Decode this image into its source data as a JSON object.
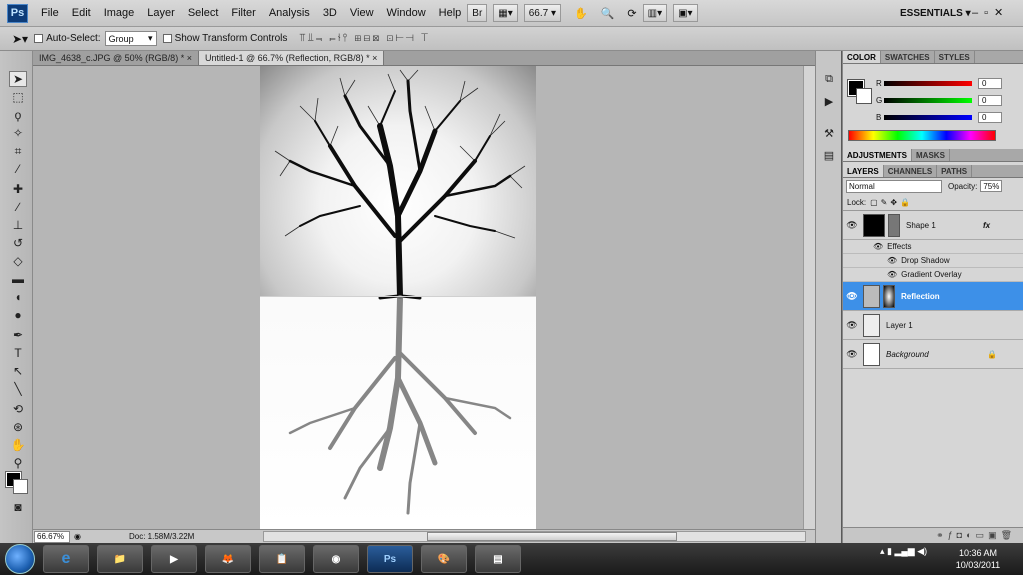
{
  "menubar": {
    "logo": "Ps",
    "items": [
      "File",
      "Edit",
      "Image",
      "Layer",
      "Select",
      "Filter",
      "Analysis",
      "3D",
      "View",
      "Window",
      "Help"
    ],
    "zoom": "66.7 ▾",
    "essentials": "ESSENTIALS ▾",
    "window_controls": "–▫✕"
  },
  "options": {
    "auto_select_label": "Auto-Select:",
    "auto_select_value": "Group",
    "transform_label": "Show Transform Controls"
  },
  "tabs": [
    {
      "label": "IMG_4638_c.JPG @ 50% (RGB/8) * ×"
    },
    {
      "label": "Untitled-1 @ 66.7% (Reflection, RGB/8) * ×"
    }
  ],
  "status": {
    "zoom": "66.67%",
    "doc": "Doc: 1.58M/3.22M"
  },
  "color_panel": {
    "tabs": [
      "COLOR",
      "SWATCHES",
      "STYLES"
    ],
    "r_label": "R",
    "g_label": "G",
    "b_label": "B",
    "r": "0",
    "g": "0",
    "b": "0"
  },
  "adjust_panel": {
    "tabs": [
      "ADJUSTMENTS",
      "MASKS"
    ]
  },
  "layers_panel": {
    "tabs": [
      "LAYERS",
      "CHANNELS",
      "PATHS"
    ],
    "blend_mode": "Normal",
    "opacity_label": "Opacity:",
    "opacity_value": "75%",
    "lock_label": "Lock:",
    "layers": [
      {
        "name": "Shape 1",
        "fx": "fx"
      },
      {
        "effects": "Effects",
        "drop_shadow": "Drop Shadow",
        "gradient_overlay": "Gradient Overlay"
      },
      {
        "name": "Reflection"
      },
      {
        "name": "Layer 1"
      },
      {
        "name": "Background"
      }
    ]
  },
  "taskbar": {
    "clock_time": "10:36 AM",
    "clock_date": "10/03/2011",
    "ps_app": "Ps"
  }
}
